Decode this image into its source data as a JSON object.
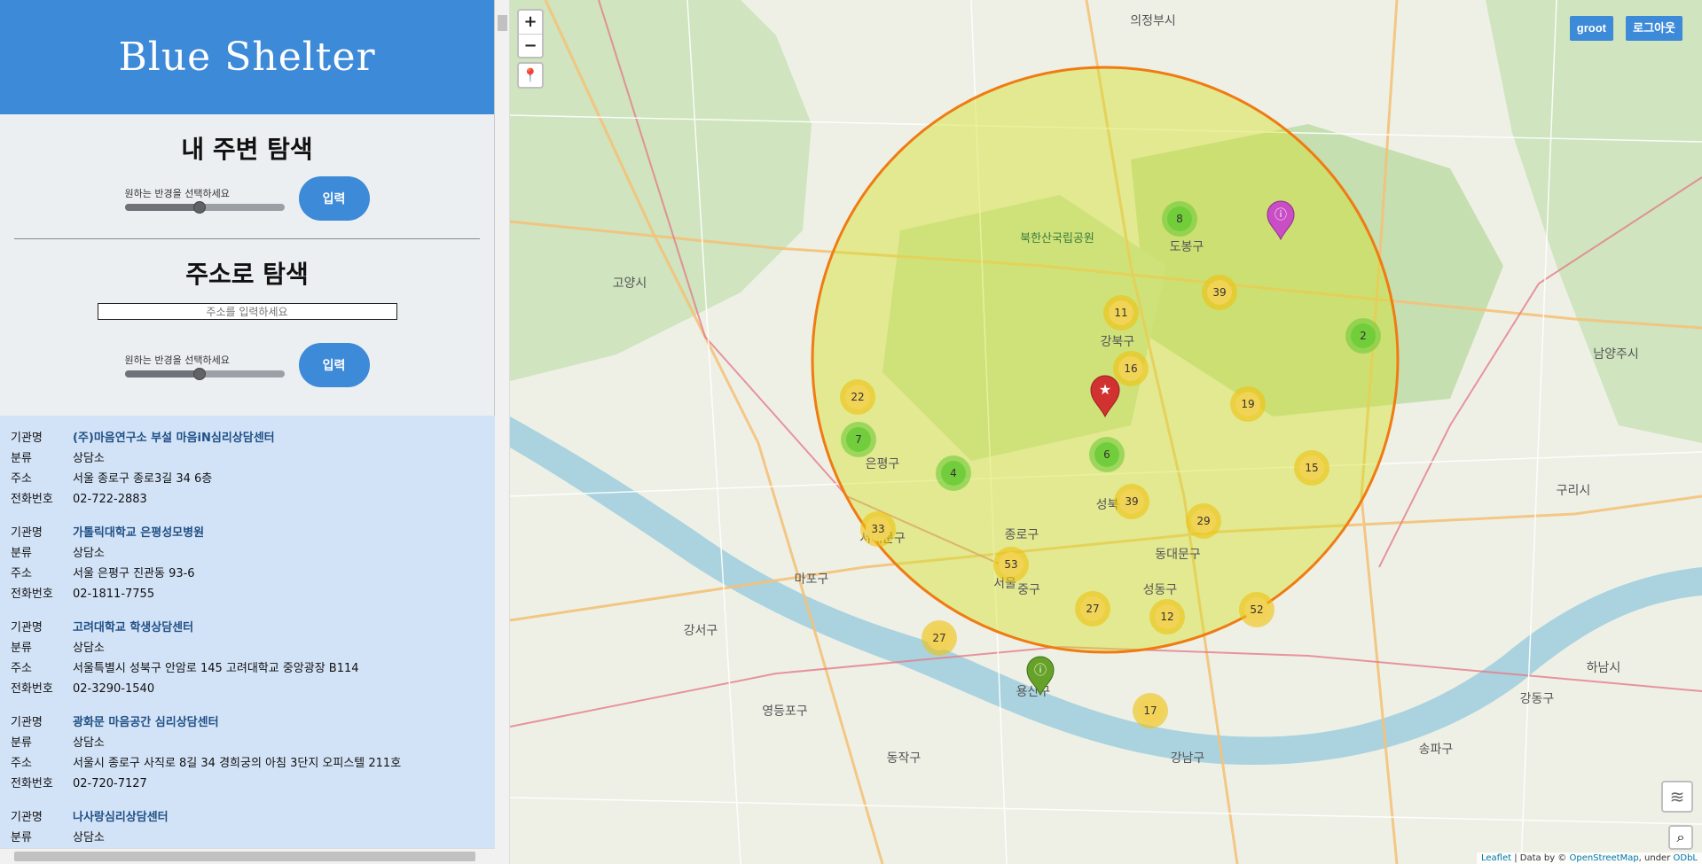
{
  "app": {
    "title": "Blue Shelter"
  },
  "nearby": {
    "title": "내 주변 탐색",
    "slider_label": "원하는 반경을 선택하세요",
    "slider_value": 0.47,
    "submit_label": "입력"
  },
  "address_search": {
    "title": "주소로 탐색",
    "placeholder": "주소를 입력하세요",
    "slider_label": "원하는 반경을 선택하세요",
    "slider_value": 0.47,
    "submit_label": "입력"
  },
  "labels": {
    "name": "기관명",
    "category": "분류",
    "address": "주소",
    "phone": "전화번호"
  },
  "results": [
    {
      "name": "(주)마음연구소 부설 마음iN심리상담센터",
      "category": "상담소",
      "address": "서울 종로구 종로3길 34 6층",
      "phone": "02-722-2883"
    },
    {
      "name": "가톨릭대학교 은평성모병원",
      "category": "상담소",
      "address": "서울 은평구 진관동 93-6",
      "phone": "02-1811-7755"
    },
    {
      "name": "고려대학교 학생상담센터",
      "category": "상담소",
      "address": "서울특별시 성북구 안암로 145 고려대학교 중앙광장 B114",
      "phone": "02-3290-1540"
    },
    {
      "name": "광화문 마음공간 심리상담센터",
      "category": "상담소",
      "address": "서울시 종로구 사직로 8길 34 경희궁의 아침 3단지 오피스텔 211호",
      "phone": "02-720-7127"
    },
    {
      "name": "나사랑심리상담센터",
      "category": "상담소",
      "address": "",
      "phone": ""
    }
  ],
  "map": {
    "zoom_in": "+",
    "zoom_out": "−",
    "user_button": "groot",
    "logout_button": "로그아웃",
    "attribution": {
      "leaflet": "Leaflet",
      "data_by": " | Data by © ",
      "osm": "OpenStreetMap",
      "under": ", under ",
      "odbl": "ODbL"
    },
    "clusters": [
      {
        "count": "8",
        "color": "green"
      },
      {
        "count": "39",
        "color": "yellow"
      },
      {
        "count": "11",
        "color": "yellow"
      },
      {
        "count": "2",
        "color": "green"
      },
      {
        "count": "16",
        "color": "yellow"
      },
      {
        "count": "22",
        "color": "yellow"
      },
      {
        "count": "19",
        "color": "yellow"
      },
      {
        "count": "7",
        "color": "green"
      },
      {
        "count": "6",
        "color": "green"
      },
      {
        "count": "4",
        "color": "green"
      },
      {
        "count": "15",
        "color": "yellow"
      },
      {
        "count": "39",
        "color": "yellow"
      },
      {
        "count": "29",
        "color": "yellow"
      },
      {
        "count": "33",
        "color": "yellow"
      },
      {
        "count": "53",
        "color": "yellow"
      },
      {
        "count": "27",
        "color": "yellow"
      },
      {
        "count": "12",
        "color": "yellow"
      },
      {
        "count": "52",
        "color": "yellow"
      },
      {
        "count": "27",
        "color": "yellow"
      },
      {
        "count": "17",
        "color": "yellow"
      }
    ],
    "place_labels": [
      "의정부시",
      "고양시",
      "구리시",
      "남양주시",
      "도봉구",
      "강북구",
      "은평구",
      "종로구",
      "성북구",
      "동대문구",
      "중구",
      "성동구",
      "용산구",
      "마포구",
      "서대문구",
      "강서구",
      "영등포구",
      "동작구",
      "강남구",
      "송파구",
      "강동구",
      "하남시",
      "서울",
      "북한산국립공원"
    ]
  }
}
